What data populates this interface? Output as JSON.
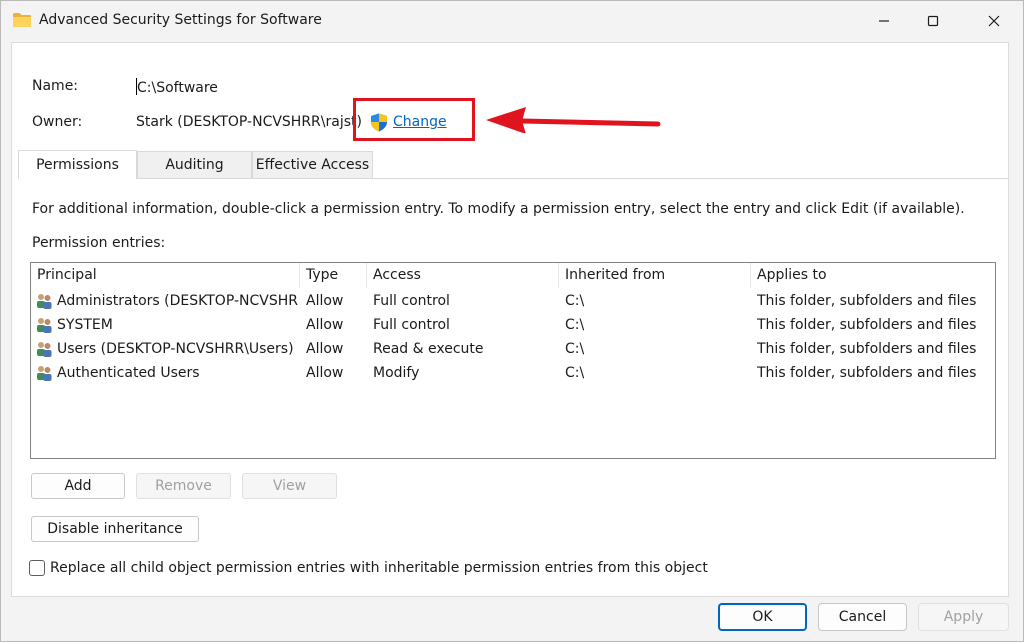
{
  "window": {
    "title": "Advanced Security Settings for Software",
    "icon": "folder-icon"
  },
  "fields": {
    "name_label": "Name:",
    "name_value": "C:\\Software",
    "owner_label": "Owner:",
    "owner_value": "Stark (DESKTOP-NCVSHRR\\rajst)",
    "change_link": "Change"
  },
  "tabs": [
    {
      "label": "Permissions",
      "active": true
    },
    {
      "label": "Auditing",
      "active": false
    },
    {
      "label": "Effective Access",
      "active": false
    }
  ],
  "info_text": "For additional information, double-click a permission entry. To modify a permission entry, select the entry and click Edit (if available).",
  "permission_entries_label": "Permission entries:",
  "table": {
    "columns": [
      "Principal",
      "Type",
      "Access",
      "Inherited from",
      "Applies to"
    ],
    "rows": [
      {
        "principal": "Administrators (DESKTOP-NCVSHRR\\Administrators)",
        "type": "Allow",
        "access": "Full control",
        "inherited": "C:\\",
        "applies": "This folder, subfolders and files"
      },
      {
        "principal": "SYSTEM",
        "type": "Allow",
        "access": "Full control",
        "inherited": "C:\\",
        "applies": "This folder, subfolders and files"
      },
      {
        "principal": "Users (DESKTOP-NCVSHRR\\Users)",
        "type": "Allow",
        "access": "Read & execute",
        "inherited": "C:\\",
        "applies": "This folder, subfolders and files"
      },
      {
        "principal": "Authenticated Users",
        "type": "Allow",
        "access": "Modify",
        "inherited": "C:\\",
        "applies": "This folder, subfolders and files"
      }
    ]
  },
  "buttons": {
    "add": "Add",
    "remove": "Remove",
    "view": "View",
    "disable_inheritance": "Disable inheritance"
  },
  "replace_checkbox": {
    "label": "Replace all child object permission entries with inheritable permission entries from this object",
    "checked": false
  },
  "footer": {
    "ok": "OK",
    "cancel": "Cancel",
    "apply": "Apply"
  },
  "colors": {
    "accent": "#0067c0",
    "annotation_red": "#e0141f"
  }
}
